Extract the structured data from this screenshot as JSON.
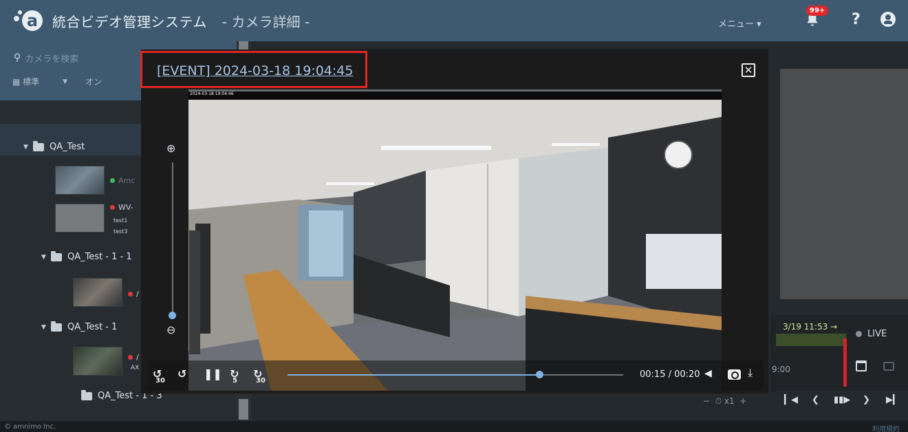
{
  "header": {
    "app_title": "統合ビデオ管理システム",
    "page_subtitle": "- カメラ詳細 -",
    "menu_label": "メニュー ▾",
    "notification_count": "99+",
    "help_label": "?"
  },
  "sidebar": {
    "search_placeholder": "カメラを検索",
    "view_select": "標準",
    "online_label": "オン",
    "tree": [
      {
        "label": "QA_Test"
      },
      {
        "label": "QA_Test - 1 - 1"
      },
      {
        "label": "QA_Test - 1"
      },
      {
        "label": "QA_Test - 1 - 3"
      }
    ],
    "cameras": [
      {
        "label": "Amc",
        "sub": ""
      },
      {
        "label": "WV-",
        "sub1": "test1",
        "sub2": "test3"
      },
      {
        "label": "/",
        "sub": ""
      },
      {
        "label": "/",
        "sub": "AX"
      }
    ]
  },
  "modal": {
    "event_title": "[EVENT] 2024-03-18 19:04:45",
    "video_timestamp": "2024-03-18 19:04:46",
    "time_display": "00:15 / 00:20",
    "progress_fraction": 0.75,
    "rewind30": "30",
    "forward5": "5",
    "forward30": "30"
  },
  "right_panel": {
    "timeline_date": "3/19 11:53 →",
    "timeline_time": "9:00",
    "live_label": "LIVE",
    "speed_label": "x1"
  },
  "footer": {
    "copyright": "© amnimo Inc.",
    "terms": "利用規約"
  },
  "colors": {
    "header": "#3f5a70",
    "accent_blue": "#7fb3e3",
    "highlight_red": "#e12822",
    "badge_red": "#e0282b"
  }
}
